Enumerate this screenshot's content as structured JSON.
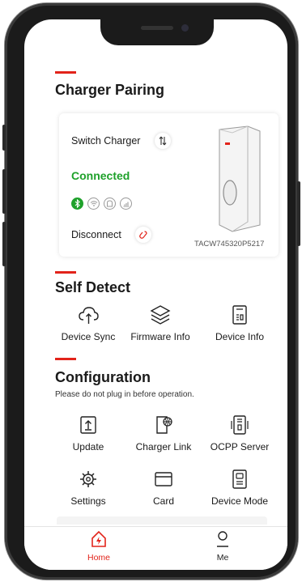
{
  "pairing": {
    "title": "Charger Pairing",
    "switch_label": "Switch Charger",
    "status": "Connected",
    "disconnect_label": "Disconnect",
    "serial": "TACW745320P5217",
    "connection_icons": [
      "bluetooth-icon",
      "wifi-icon",
      "ethernet-icon",
      "cellular-icon"
    ],
    "brand_color": "#e2231a",
    "status_color": "#1fa12b"
  },
  "self_detect": {
    "title": "Self Detect",
    "items": [
      {
        "label": "Device Sync",
        "icon": "cloud-sync-icon"
      },
      {
        "label": "Firmware Info",
        "icon": "layers-icon"
      },
      {
        "label": "Device Info",
        "icon": "device-info-icon"
      }
    ]
  },
  "configuration": {
    "title": "Configuration",
    "note": "Please do not plug in before operation.",
    "items": [
      {
        "label": "Update",
        "icon": "update-icon"
      },
      {
        "label": "Charger Link",
        "icon": "charger-link-icon"
      },
      {
        "label": "OCPP Server",
        "icon": "ocpp-server-icon"
      },
      {
        "label": "Settings",
        "icon": "gear-icon"
      },
      {
        "label": "Card",
        "icon": "card-icon"
      },
      {
        "label": "Device Mode",
        "icon": "device-mode-icon"
      }
    ]
  },
  "tabbar": {
    "tabs": [
      {
        "label": "Home",
        "icon": "home-icon",
        "active": true
      },
      {
        "label": "Me",
        "icon": "user-icon",
        "active": false
      }
    ]
  }
}
